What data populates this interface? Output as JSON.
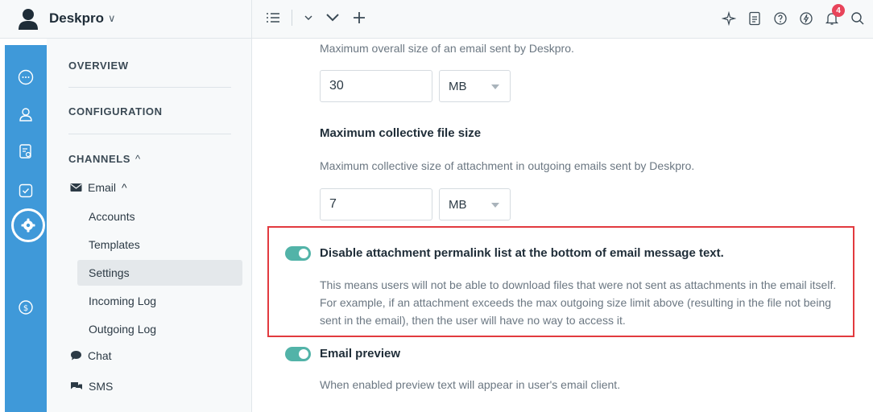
{
  "app": {
    "brand": "Deskpro",
    "brand_chevron": "∨"
  },
  "topbar": {
    "tools": {
      "list_icon": "☰",
      "chevron": "⌄",
      "chevron_big": "∨",
      "plus": "+"
    },
    "notification_count": "4"
  },
  "nav": {
    "overview": "OVERVIEW",
    "configuration": "CONFIGURATION",
    "channels": "CHANNELS",
    "channels_chevron": "^",
    "email_group": "Email",
    "email_chevron": "^",
    "email_items": [
      {
        "label": "Accounts"
      },
      {
        "label": "Templates"
      },
      {
        "label": "Settings"
      },
      {
        "label": "Incoming Log"
      },
      {
        "label": "Outgoing Log"
      }
    ],
    "chat": "Chat",
    "sms": "SMS"
  },
  "main": {
    "cut_text": "Maximum overall size of an email sent by Deskpro.",
    "max_overall": {
      "value": "30",
      "unit": "MB"
    },
    "collective": {
      "title": "Maximum collective file size",
      "description": "Maximum collective size of attachment in outgoing emails sent by Deskpro.",
      "value": "7",
      "unit": "MB"
    },
    "permalink_option": {
      "title": "Disable attachment permalink list at the bottom of email message text.",
      "description": "This means users will not be able to download files that were not sent as attachments in the email itself. For example, if an attachment exceeds the max outgoing size limit above (resulting in the file not being sent in the email), then the user will have no way to access it.",
      "enabled": true
    },
    "preview_option": {
      "title": "Email preview",
      "description": "When enabled preview text will appear in user's email client.",
      "enabled": true
    }
  },
  "colors": {
    "rail": "#3f99d9",
    "toggle": "#52b3a8",
    "highlight": "#e23a3f",
    "badge": "#e8445a"
  }
}
